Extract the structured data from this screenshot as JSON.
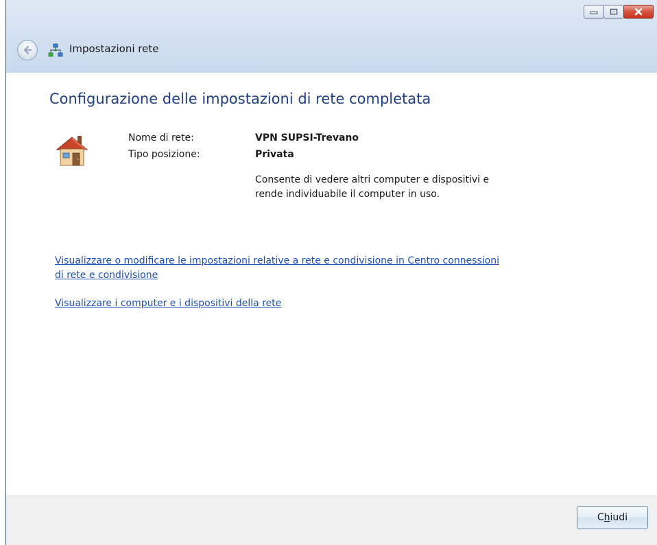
{
  "window": {
    "title": "Impostazioni rete"
  },
  "icons": {
    "back": "back-arrow-icon",
    "network": "network-icon",
    "house": "home-network-icon",
    "minimize": "minimize-icon",
    "maximize": "maximize-icon",
    "close": "close-icon"
  },
  "main": {
    "heading": "Configurazione delle impostazioni di rete completata",
    "network_name_label": "Nome di rete:",
    "network_name_value": "VPN SUPSI-Trevano",
    "location_type_label": "Tipo posizione:",
    "location_type_value": "Privata",
    "location_description": "Consente di vedere altri computer e dispositivi e rende individuabile il computer in uso.",
    "link_sharing_center": "Visualizzare o modificare le impostazioni relative a rete e condivisione in Centro connessioni di rete e condivisione",
    "link_view_devices": "Visualizzare i computer e i dispositivi della rete"
  },
  "footer": {
    "close_button_prefix": "C",
    "close_button_accel": "h",
    "close_button_suffix": "iudi"
  },
  "colors": {
    "heading": "#1e3f87",
    "link": "#1b4fb6",
    "chrome": "#d3e1f1",
    "footer": "#f0f0f0"
  }
}
